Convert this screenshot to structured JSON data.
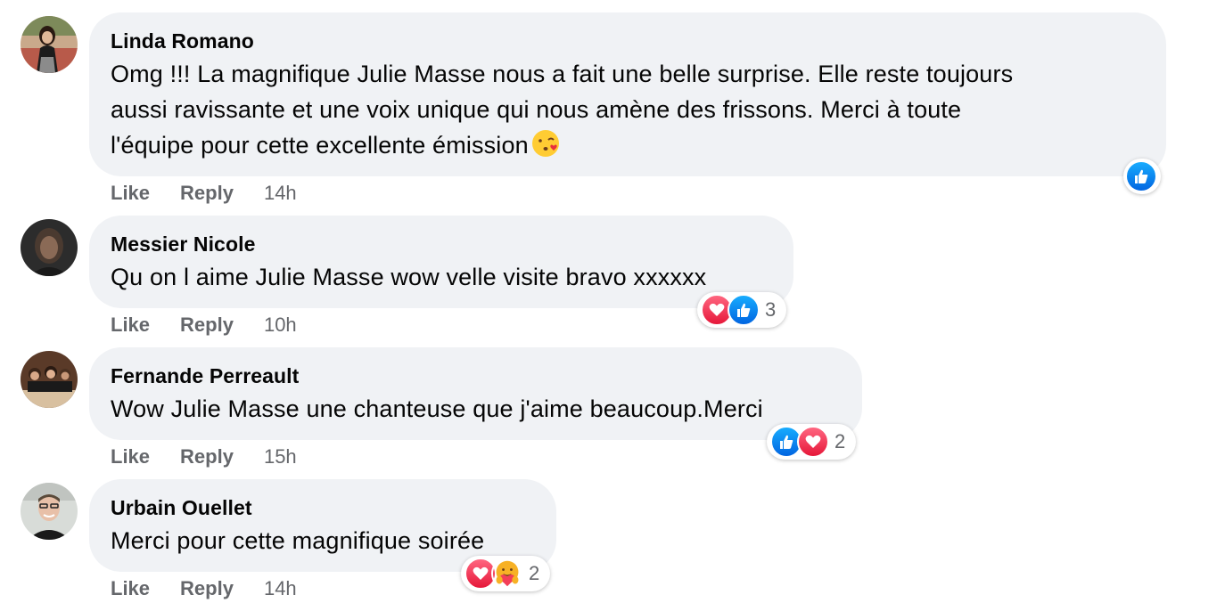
{
  "comments": [
    {
      "author": "Linda Romano",
      "lines": [
        "Omg !!! La magnifique Julie Masse nous a fait une belle surprise. Elle reste toujours",
        "aussi ravissante et une voix unique qui nous amène des frissons. Merci à toute",
        "l'équipe pour cette excellente émission"
      ],
      "emoji": "kissing-face-emoji",
      "like_label": "Like",
      "reply_label": "Reply",
      "time": "14h",
      "reactions": [
        "like-icon"
      ],
      "reaction_count": ""
    },
    {
      "author": "Messier Nicole",
      "lines": [
        "Qu on l aime Julie Masse wow velle visite bravo xxxxxx"
      ],
      "like_label": "Like",
      "reply_label": "Reply",
      "time": "10h",
      "reactions": [
        "love-icon",
        "like-icon"
      ],
      "reaction_count": "3"
    },
    {
      "author": "Fernande Perreault",
      "lines": [
        "Wow Julie Masse une chanteuse que j'aime beaucoup.Merci"
      ],
      "like_label": "Like",
      "reply_label": "Reply",
      "time": "15h",
      "reactions": [
        "like-icon",
        "love-icon"
      ],
      "reaction_count": "2"
    },
    {
      "author": "Urbain Ouellet",
      "lines": [
        "Merci pour cette magnifique soirée"
      ],
      "like_label": "Like",
      "reply_label": "Reply",
      "time": "14h",
      "reactions": [
        "love-icon",
        "care-icon"
      ],
      "reaction_count": "2"
    }
  ],
  "colors": {
    "bubble": "#f0f2f5",
    "secondary_text": "#65676b",
    "like_blue": "#1877f2",
    "love_red": "#f33e58"
  }
}
